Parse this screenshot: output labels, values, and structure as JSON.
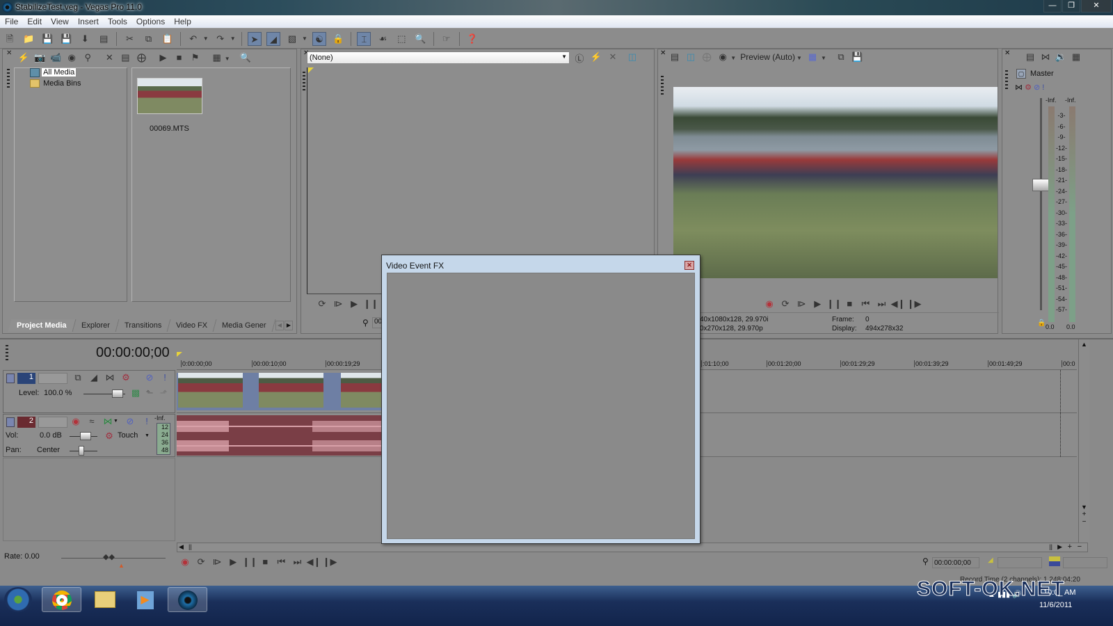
{
  "window": {
    "title": "StabilizeTest.veg - Vegas Pro 11.0",
    "controls": [
      "minimize",
      "restore",
      "close"
    ]
  },
  "menubar": [
    "File",
    "Edit",
    "View",
    "Insert",
    "Tools",
    "Options",
    "Help"
  ],
  "toolbar": {
    "buttons": [
      "new",
      "open",
      "save",
      "save-as",
      "render",
      "properties",
      "cut",
      "copy",
      "paste",
      "undo",
      "redo",
      "normal-edit-tool",
      "envelope-edit-tool",
      "auto-ripple",
      "snapping",
      "lock-envelopes",
      "enable-snapping",
      "ignore-grouping",
      "selection-tool",
      "zoom-tool",
      "split",
      "help"
    ]
  },
  "media_panel": {
    "tree": [
      {
        "label": "All Media",
        "selected": true,
        "icon": "film-icon"
      },
      {
        "label": "Media Bins",
        "selected": false,
        "icon": "folder-icon"
      }
    ],
    "media_items": [
      {
        "filename": "00069.MTS"
      }
    ],
    "tabs": [
      "Project Media",
      "Explorer",
      "Transitions",
      "Video FX",
      "Media Gener"
    ],
    "active_tab": "Project Media"
  },
  "trimmer": {
    "dropdown_value": "(None)",
    "timecode_partial": "00"
  },
  "preview": {
    "mode": "Preview (Auto)",
    "project_info": "40x1080x128, 29.970i",
    "preview_info": "0x270x128, 29.970p",
    "frame_label": "Frame:",
    "frame_value": "0",
    "display_label": "Display:",
    "display_value": "494x278x32"
  },
  "master_bus": {
    "label": "Master",
    "peak_left": "-Inf.",
    "peak_right": "-Inf.",
    "scale": [
      "3",
      "6",
      "9",
      "12",
      "15",
      "18",
      "21",
      "24",
      "27",
      "30",
      "33",
      "36",
      "39",
      "42",
      "45",
      "48",
      "51",
      "54",
      "57"
    ],
    "bottom_left": "0.0",
    "bottom_right": "0.0"
  },
  "timeline": {
    "cursor_time": "00:00:00;00",
    "ruler_ticks": [
      "0:00:00;00",
      "00:00:10;00",
      "00:00:19;29",
      ":01:10;00",
      "00:01:20;00",
      "00:01:29;29",
      "00:01:39;29",
      "00:01:49;29",
      "00:0"
    ],
    "tracks": [
      {
        "type": "video",
        "number": "1",
        "level_label": "Level:",
        "level_value": "100.0 %"
      },
      {
        "type": "audio",
        "number": "2",
        "vol_label": "Vol:",
        "vol_value": "0.0 dB",
        "pan_label": "Pan:",
        "pan_value": "Center",
        "automation": "Touch",
        "meter_peak": "-Inf.",
        "meter_scale": [
          "12",
          "24",
          "36",
          "48"
        ]
      }
    ],
    "rate_label": "Rate: 0.00",
    "transport_timecode": "00:00:00;00",
    "record_time": "Record Time (2 channels): 1,248:04:20"
  },
  "dialog": {
    "title": "Video Event FX"
  },
  "taskbar": {
    "items": [
      "start",
      "chrome",
      "explorer",
      "media-player",
      "vegas-pro"
    ],
    "active": "vegas-pro",
    "clock_time": "10:0_ AM",
    "clock_date": "11/6/2011"
  },
  "watermark": "SOFT-OK.NET"
}
